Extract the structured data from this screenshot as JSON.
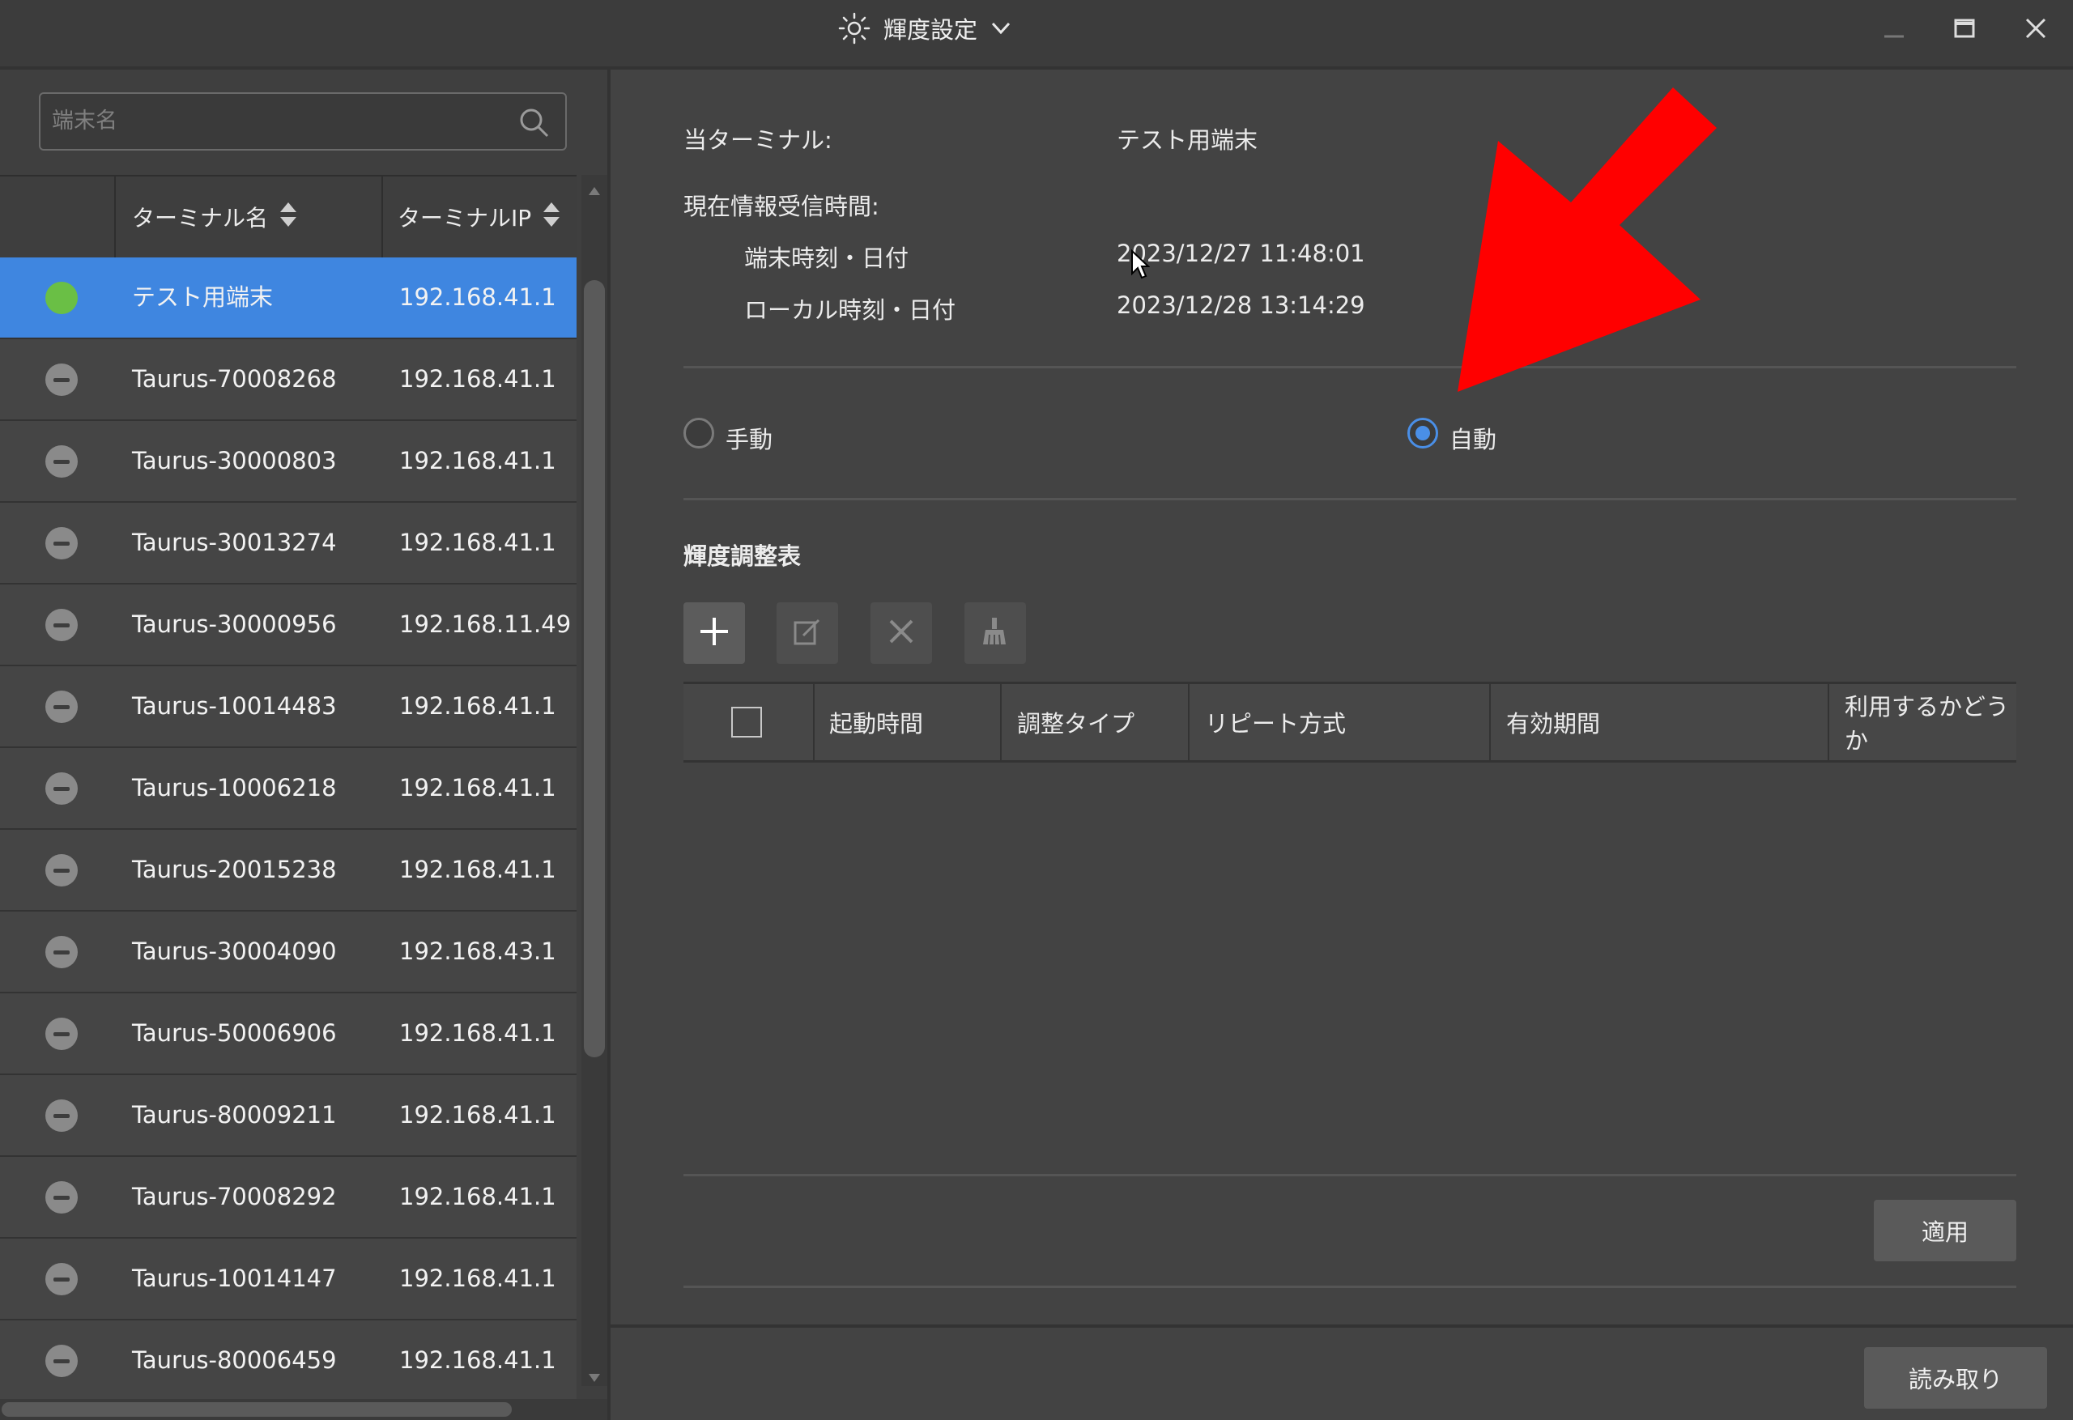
{
  "window": {
    "title": "輝度設定",
    "icons": {
      "app": "sun-icon",
      "dropdown": "chevron-down-icon",
      "minimize": "minimize-icon",
      "maximize": "maximize-icon",
      "close": "close-icon"
    }
  },
  "sidebar": {
    "search_placeholder": "端末名",
    "columns": {
      "name": "ターミナル名",
      "ip": "ターミナルIP"
    },
    "rows": [
      {
        "name": "テスト用端末",
        "ip": "192.168.41.1",
        "status": "online",
        "selected": true
      },
      {
        "name": "Taurus-70008268",
        "ip": "192.168.41.1",
        "status": "offline"
      },
      {
        "name": "Taurus-30000803",
        "ip": "192.168.41.1",
        "status": "offline"
      },
      {
        "name": "Taurus-30013274",
        "ip": "192.168.41.1",
        "status": "offline"
      },
      {
        "name": "Taurus-30000956",
        "ip": "192.168.11.49",
        "status": "offline"
      },
      {
        "name": "Taurus-10014483",
        "ip": "192.168.41.1",
        "status": "offline"
      },
      {
        "name": "Taurus-10006218",
        "ip": "192.168.41.1",
        "status": "offline"
      },
      {
        "name": "Taurus-20015238",
        "ip": "192.168.41.1",
        "status": "offline"
      },
      {
        "name": "Taurus-30004090",
        "ip": "192.168.43.1",
        "status": "offline"
      },
      {
        "name": "Taurus-50006906",
        "ip": "192.168.41.1",
        "status": "offline"
      },
      {
        "name": "Taurus-80009211",
        "ip": "192.168.41.1",
        "status": "offline"
      },
      {
        "name": "Taurus-70008292",
        "ip": "192.168.41.1",
        "status": "offline"
      },
      {
        "name": "Taurus-10014147",
        "ip": "192.168.41.1",
        "status": "offline"
      },
      {
        "name": "Taurus-80006459",
        "ip": "192.168.41.1",
        "status": "offline"
      }
    ]
  },
  "info": {
    "current_terminal_label": "当ターミナル:",
    "current_terminal_value": "テスト用端末",
    "received_time_label": "現在情報受信時間:",
    "terminal_time_label": "端末時刻・日付",
    "terminal_time_value": "2023/12/27 11:48:01",
    "local_time_label": "ローカル時刻・日付",
    "local_time_value": "2023/12/28 13:14:29"
  },
  "mode": {
    "manual_label": "手動",
    "auto_label": "自動",
    "selected": "auto"
  },
  "schedule": {
    "title": "輝度調整表",
    "toolbar_icons": [
      "plus-icon",
      "edit-icon",
      "delete-icon",
      "clear-icon"
    ],
    "columns": [
      "起動時間",
      "調整タイプ",
      "リピート方式",
      "有効期間",
      "利用するかどうか"
    ],
    "rows": []
  },
  "buttons": {
    "apply": "適用",
    "read": "読み取り"
  },
  "colors": {
    "background": "#434343",
    "selected_row": "#3f86e0",
    "online": "#6abf45",
    "radio_checked": "#4a8fe7",
    "annotation_arrow": "#ff0000"
  }
}
